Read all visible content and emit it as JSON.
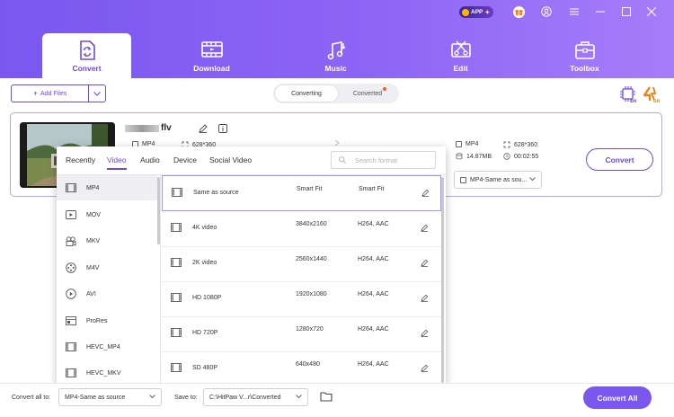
{
  "header": {
    "app_badge": "APP",
    "tabs": [
      {
        "label": "Convert",
        "icon": "convert-icon",
        "active": true
      },
      {
        "label": "Download",
        "icon": "download-icon",
        "active": false
      },
      {
        "label": "Music",
        "icon": "music-icon",
        "active": false
      },
      {
        "label": "Edit",
        "icon": "edit-icon",
        "active": false
      },
      {
        "label": "Toolbox",
        "icon": "toolbox-icon",
        "active": false
      }
    ],
    "accent": "#7b57f0"
  },
  "toolbar": {
    "add_files": "Add Files",
    "segment": {
      "converting": "Converting",
      "converted": "Converted",
      "active": "converting"
    }
  },
  "file": {
    "name_suffix": "flv",
    "source_format": "MP4",
    "source_resolution": "628*360",
    "output_format": "MP4",
    "output_resolution": "628*360",
    "output_size": "14.87MB",
    "output_duration": "00:02:55",
    "convert_label": "Convert",
    "format_select": "MP4-Same as sou..."
  },
  "format_popup": {
    "tabs": [
      "Recently",
      "Video",
      "Audio",
      "Device",
      "Social Video"
    ],
    "active_tab": "Video",
    "search_placeholder": "Search format",
    "formats": [
      {
        "label": "MP4",
        "icon": "mp4-icon"
      },
      {
        "label": "MOV",
        "icon": "mov-icon"
      },
      {
        "label": "MKV",
        "icon": "mkv-icon"
      },
      {
        "label": "M4V",
        "icon": "m4v-icon"
      },
      {
        "label": "AVI",
        "icon": "avi-icon"
      },
      {
        "label": "ProRes",
        "icon": "prores-icon"
      },
      {
        "label": "HEVC_MP4",
        "icon": "hevc-icon"
      },
      {
        "label": "HEVC_MKV",
        "icon": "hevc-icon"
      }
    ],
    "selected_format": "MP4",
    "presets": [
      {
        "name": "Same as source",
        "res": "Smart Fit",
        "codec": "Smart Fit"
      },
      {
        "name": "4K video",
        "res": "3840x2160",
        "codec": "H264, AAC"
      },
      {
        "name": "2K video",
        "res": "2560x1440",
        "codec": "H264, AAC"
      },
      {
        "name": "HD 1080P",
        "res": "1920x1080",
        "codec": "H264, AAC"
      },
      {
        "name": "HD 720P",
        "res": "1280x720",
        "codec": "H264, AAC"
      },
      {
        "name": "SD 480P",
        "res": "640x480",
        "codec": "H264, AAC"
      }
    ]
  },
  "bottom": {
    "convert_all_to_label": "Convert all to:",
    "convert_all_to_value": "MP4-Same as source",
    "save_to_label": "Save to:",
    "save_to_value": "C:\\HitPaw V...r\\Converted",
    "convert_all_button": "Convert All"
  }
}
